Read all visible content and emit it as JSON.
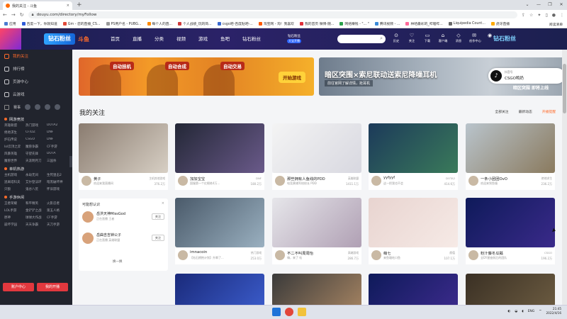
{
  "browser": {
    "tab_title": "我的关注 - 斗鱼",
    "tab_close": "×",
    "new_tab": "+",
    "url": "douyu.com/directory/myFollow",
    "window_controls": [
      "⌄",
      "—",
      "❐",
      "✕"
    ]
  },
  "bookmarks": {
    "items": [
      {
        "label": "应用",
        "color": "#4a7bd0"
      },
      {
        "label": "百度一下，你就知道",
        "color": "#2f5bd8"
      },
      {
        "label": "Gm - 您的直播_CS...",
        "color": "#e04a3a"
      },
      {
        "label": "PS用户名 - PUBG...",
        "color": "#9a9a9a"
      },
      {
        "label": "每个人的直...",
        "color": "#ff8a00"
      },
      {
        "label": "个人战绩_玩的简...",
        "color": "#d03b3b"
      },
      {
        "label": "csgo吧-百度贴吧-...",
        "color": "#3a6ad0"
      },
      {
        "label": "淘宝网 - 淘！我喜欢",
        "color": "#ff5a00"
      },
      {
        "label": "我的首页 微博-随...",
        "color": "#e0303a"
      },
      {
        "label": "网络赚钱 - \"... \"",
        "color": "#2aa04a"
      },
      {
        "label": "腾讯视频 - ...",
        "color": "#3a8ad8"
      },
      {
        "label": "林哈最彩的_哔哩哔...",
        "color": "#ff6a9a"
      },
      {
        "label": "Liquipedia Count...",
        "color": "#6a6a6a"
      },
      {
        "label": "虎牙直播",
        "color": "#ffaa00"
      }
    ],
    "right_label": "阅读清单"
  },
  "douyu_header": {
    "logo": "钻石粉丝",
    "brand": "斗鱼",
    "nav": [
      "首页",
      "直播",
      "分类",
      "视频",
      "游戏",
      "鱼吧",
      "钻石粉丝"
    ],
    "vip_line1": "钻石粉丝",
    "vip_line2": "大宝开播",
    "search_icon": "search-icon",
    "icons": [
      {
        "glyph": "⊙",
        "label": "历史"
      },
      {
        "glyph": "♡",
        "label": "关注"
      },
      {
        "glyph": "▭",
        "label": "下载"
      },
      {
        "glyph": "⌂",
        "label": "客户端"
      },
      {
        "glyph": "◇",
        "label": "消息"
      },
      {
        "glyph": "✉",
        "label": "创作中心"
      },
      {
        "glyph": "◉",
        "label": ""
      }
    ],
    "right_logo": "钻石粉丝"
  },
  "sidebar": {
    "items": [
      {
        "label": "我的关注",
        "active": true
      },
      {
        "label": "排行榜",
        "active": false
      },
      {
        "label": "页游中心",
        "active": false
      },
      {
        "label": "云游戏",
        "active": false
      }
    ],
    "event_label": "赛事",
    "sections": [
      {
        "title": "网游竞技",
        "items": [
          "英雄联盟",
          "热门游戏",
          "DOTA2",
          "绝地求生",
          "CF/DZ",
          "DNF",
          "炉石传说",
          "CSGO",
          "DNF",
          "lol云顶之弈",
          "魔兽争霸",
          "CF手游",
          "风暴英雄",
          "守望先锋",
          "DOTA",
          "魔兽世界",
          "天涯明月刀",
          "三国杀"
        ]
      },
      {
        "title": "单机热游",
        "items": [
          "主机游戏",
          "永劫无间",
          "生死狙击2",
          "逃离塔科夫",
          "艾尔登法环",
          "暗黑破坏神",
          "只狼",
          "鬼谷八荒",
          "怀旧游戏"
        ]
      },
      {
        "title": "手游休闲",
        "items": [
          "王者荣耀",
          "和平精英",
          "火影忍者",
          "LOL手游",
          "金铲铲之战",
          "第五人格",
          "原神",
          "球球大作战",
          "CF手游",
          "崩坏学园",
          "天天争霸",
          "天刀手游"
        ]
      }
    ],
    "btn_left": "账户中心",
    "btn_right": "我的开播"
  },
  "banners": {
    "left_tags": [
      "自动挂机",
      "自动合成",
      "自动交易"
    ],
    "left_play": "开始游戏",
    "right_title": "暗区突围×索尼联动送索尼降噪耳机",
    "right_sub": "前往官网了解详情，抢耳机",
    "right_corner": "暗区突围 即将上线"
  },
  "tiktok": {
    "small": "抖音号",
    "name": "CSGO鸭奶",
    "glyph": "♪"
  },
  "my_follow": {
    "title": "我的关注",
    "filter_all": "全部关注",
    "filter_sort": "最新动态",
    "filter_remind": "开播提醒"
  },
  "cards": [
    {
      "name": "黄子",
      "cat": "主机其他游戏",
      "sub": "欢迎来我直播间",
      "hot": "376.2万"
    },
    {
      "name": "加加宝宝",
      "cat": "DNF",
      "sub": "国服第一个红眼练4万...",
      "hot": "180.2万"
    },
    {
      "name": "那些拥有人鱼线的PDD",
      "cat": "英雄联盟",
      "sub": "电竞黄埔军校校长 PDD",
      "hot": "1411.1万"
    },
    {
      "name": "yyfyyf",
      "cat": "DOTA2",
      "sub": "这一把我也不会",
      "hot": "414.6万"
    },
    {
      "name": "一条小团团OvO",
      "cat": "绝地求生",
      "sub": "欢迎来到鱼塘",
      "hot": "236.2万"
    },
    {
      "name": "imnacoin",
      "cat": "热门游戏",
      "sub": "【钻石拥抱计划】升瞬了...",
      "hot": "253.0万"
    },
    {
      "name": "不二不叫周周怡",
      "cat": "高端游戏",
      "sub": "嗨，来了 哇",
      "hot": "286.7万"
    },
    {
      "name": "萌七",
      "cat": "颜值",
      "sub": "来鱼塘吃口鱼",
      "hot": "107.1万"
    },
    {
      "name": "粉汁藤冬瓜瓢",
      "cat": "CSGO",
      "sub": "全DY星座前后的团队",
      "hot": "196.2万"
    },
    {
      "name": "",
      "cat": "",
      "sub": "",
      "hot": ""
    },
    {
      "name": "",
      "cat": "",
      "sub": "",
      "hot": ""
    },
    {
      "name": "",
      "cat": "",
      "sub": "",
      "hot": ""
    },
    {
      "name": "",
      "cat": "",
      "sub": "",
      "hot": ""
    }
  ],
  "recommend": {
    "title": "可能想认识",
    "close": "×",
    "users": [
      {
        "name": "岳洪天神MissGod",
        "desc": "正在直播 王者",
        "follow": "关注"
      },
      {
        "name": "岳曲吉吉钟公子",
        "desc": "正在直播 英雄联盟",
        "follow": "关注"
      }
    ],
    "swap": "换一换"
  },
  "taskbar": {
    "lang": "ENG",
    "time": "21:45",
    "date": "2022/4/16"
  }
}
